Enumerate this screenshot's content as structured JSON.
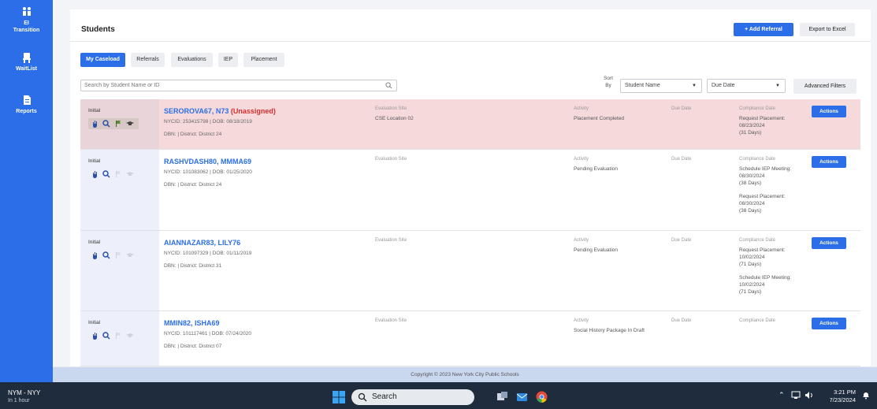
{
  "sidebar": {
    "items": [
      {
        "label": "EI Transition",
        "line1": "EI",
        "line2": "Transition",
        "icon": "transition-icon"
      },
      {
        "label": "WaitList",
        "icon": "waitlist-chair-icon"
      },
      {
        "label": "Reports",
        "icon": "document-icon"
      }
    ]
  },
  "header": {
    "title": "Students",
    "add_referral": "+ Add Referral",
    "export": "Export to Excel"
  },
  "tabs": [
    {
      "label": "My Caseload",
      "active": true
    },
    {
      "label": "Referrals",
      "active": false
    },
    {
      "label": "Evaluations",
      "active": false
    },
    {
      "label": "IEP",
      "active": false
    },
    {
      "label": "Placement",
      "active": false
    }
  ],
  "search": {
    "placeholder": "Search by Student Name or ID",
    "icon": "search-icon"
  },
  "sort": {
    "label_line1": "Sort",
    "label_line2": "By",
    "value": "Student Name",
    "second_value": "Due Date"
  },
  "advanced_filters": "Advanced Filters",
  "columns": {
    "evaluation_site": "Evaluation Site",
    "activity": "Activity",
    "due_date": "Due Date",
    "compliance_date": "Compliance Date"
  },
  "actions_label": "Actions",
  "students": [
    {
      "status": "Initial",
      "name": "SEROROVA67, N73",
      "unassigned": "(Unassigned)",
      "ids": "NYCID: 253415798 | DOB: 08/18/2019",
      "district": "DBN: | District: District 24",
      "evaluation_site": "CSE Location 02",
      "activity": "Placement Completed",
      "compliance": [
        "Request Placement:",
        "08/23/2024",
        "(31 Days)"
      ],
      "highlight": true
    },
    {
      "status": "Initial",
      "name": "RASHVDASH80, MMMA69",
      "ids": "NYCID: 101083062 | DOB: 01/25/2020",
      "district": "DBN: | District: District 24",
      "evaluation_site": "",
      "activity": "Pending Evaluation",
      "compliance": [
        "Schedule IEP Meeting:",
        "08/30/2024",
        "(38 Days)",
        "",
        "Request Placement:",
        "08/30/2024",
        "(38 Days)"
      ],
      "highlight": false
    },
    {
      "status": "Initial",
      "name": "AIANNAZAR83, LILY76",
      "ids": "NYCID: 101097329 | DOB: 01/11/2019",
      "district": "DBN: | District: District 31",
      "evaluation_site": "",
      "activity": "Pending Evaluation",
      "compliance": [
        "Request Placement:",
        "10/02/2024",
        "(71 Days)",
        "",
        "Schedule IEP Meeting:",
        "10/02/2024",
        "(71 Days)"
      ],
      "highlight": false
    },
    {
      "status": "Initial",
      "name": "MMIN82, ISHA69",
      "ids": "NYCID: 101117461 | DOB: 07/24/2020",
      "district": "DBN: | District: District 07",
      "evaluation_site": "",
      "activity": "Social History Package In Draft",
      "compliance": [],
      "highlight": false
    }
  ],
  "footer": "Copyright © 2023 New York City Public Schools",
  "taskbar": {
    "tz_title": "NYM - NYY",
    "tz_sub": "In 1 hour",
    "search": "Search",
    "time": "3:21 PM",
    "date": "7/23/2024"
  }
}
